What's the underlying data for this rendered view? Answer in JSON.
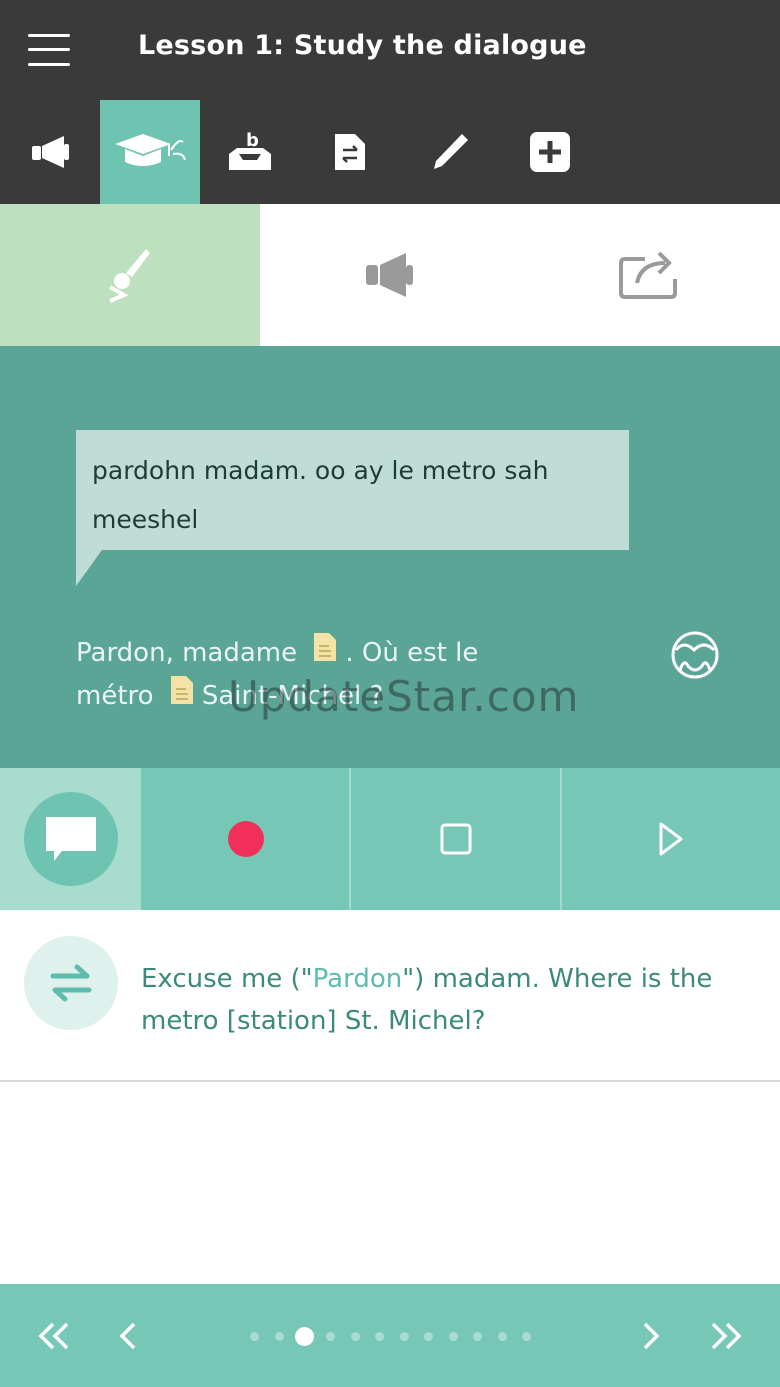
{
  "header": {
    "title": "Lesson 1: Study the dialogue"
  },
  "toolbar": {
    "tabs": [
      {
        "icon": "megaphone-icon",
        "active": false
      },
      {
        "icon": "graduation-cap-icon",
        "active": true
      },
      {
        "icon": "inbox-b-icon",
        "active": false
      },
      {
        "icon": "translate-document-icon",
        "active": false
      },
      {
        "icon": "pencil-icon",
        "active": false
      },
      {
        "icon": "plus-box-icon",
        "active": false
      }
    ]
  },
  "modes": [
    {
      "icon": "brush-icon",
      "active": true
    },
    {
      "icon": "speaker-icon",
      "active": false
    },
    {
      "icon": "share-icon",
      "active": false
    }
  ],
  "dialogue": {
    "phonetic": "pardohn madam. oo ay le metro sah meeshel",
    "source_part1": "Pardon, madame",
    "source_part2": ". Où est le métro",
    "source_part3": "Saint-Michel ?",
    "watermark": "UpdateStar.com"
  },
  "recorder": {
    "buttons": [
      "chat-icon",
      "record-icon",
      "stop-icon",
      "play-icon"
    ]
  },
  "translation": {
    "before": "Excuse me (\"",
    "highlight": "Pardon",
    "after": "\") madam. Where is the metro [station] St. Michel?"
  },
  "pager": {
    "total": 12,
    "current": 3
  },
  "colors": {
    "appbar": "#3a3a3a",
    "accent": "#6ec4b0",
    "dialogue_bg": "#5aa596",
    "record": "#f0305a"
  }
}
